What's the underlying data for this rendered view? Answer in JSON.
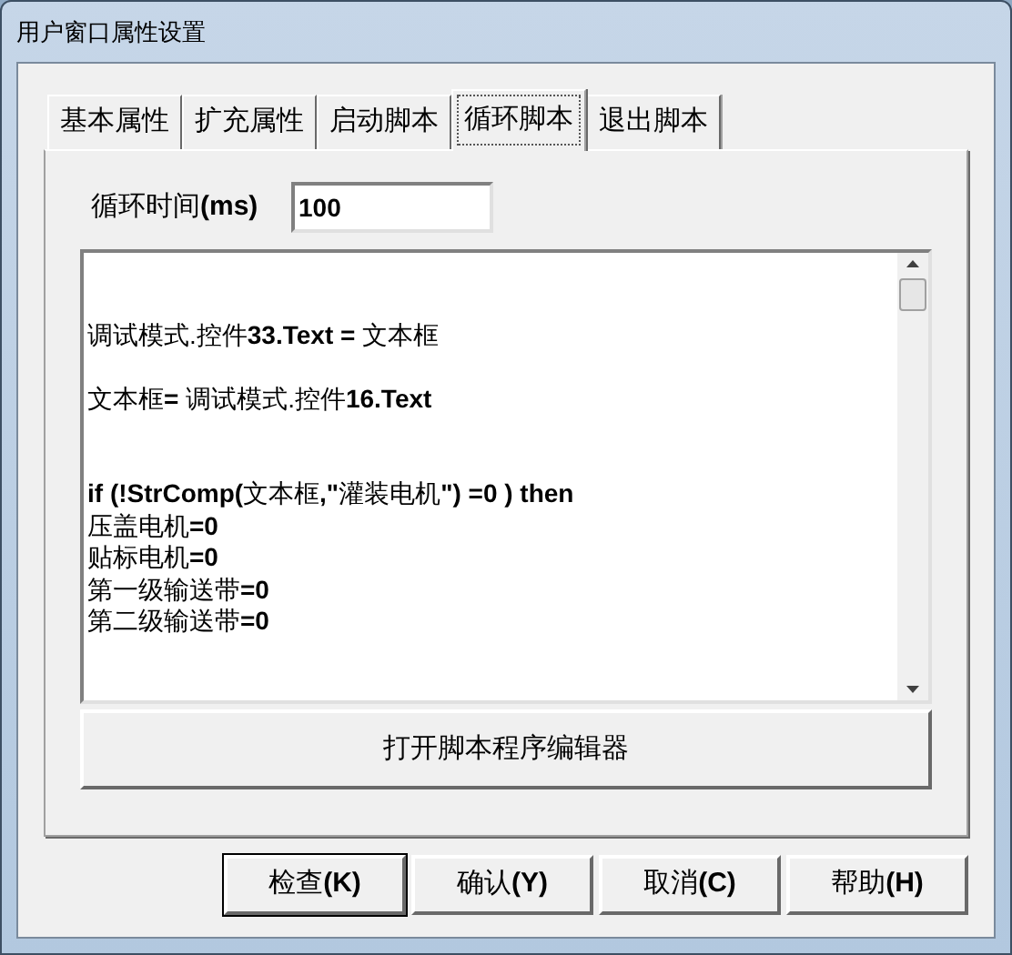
{
  "window": {
    "title": "用户窗口属性设置"
  },
  "tabs": [
    {
      "label": "基本属性",
      "selected": false
    },
    {
      "label": "扩充属性",
      "selected": false
    },
    {
      "label": "启动脚本",
      "selected": false
    },
    {
      "label": "循环脚本",
      "selected": true
    },
    {
      "label": "退出脚本",
      "selected": false
    }
  ],
  "cycle_time": {
    "label": "循环时间**(ms)**",
    "value": "100"
  },
  "script_editor": {
    "blocks": [
      {
        "lines": [
          "调试模式.控件**33.Text =** 文本框"
        ]
      },
      {
        "lines": [
          "文本框**=** 调试模式.控件**16.Text**"
        ]
      },
      {
        "lines": [
          "**if (!StrComp(**文本框**,\"**灌装电机**\") =0 ) then**",
          "压盖电机**=0**",
          "贴标电机**=0**",
          "第一级输送带**=0**",
          "第二级输送带**=0**"
        ]
      }
    ]
  },
  "open_editor_button": "打开脚本程序编辑器",
  "buttons": [
    {
      "label": "检查**(K)**",
      "default": true
    },
    {
      "label": "确认**(Y)**",
      "default": false
    },
    {
      "label": "取消**(C)**",
      "default": false
    },
    {
      "label": "帮助**(H)**",
      "default": false
    }
  ]
}
